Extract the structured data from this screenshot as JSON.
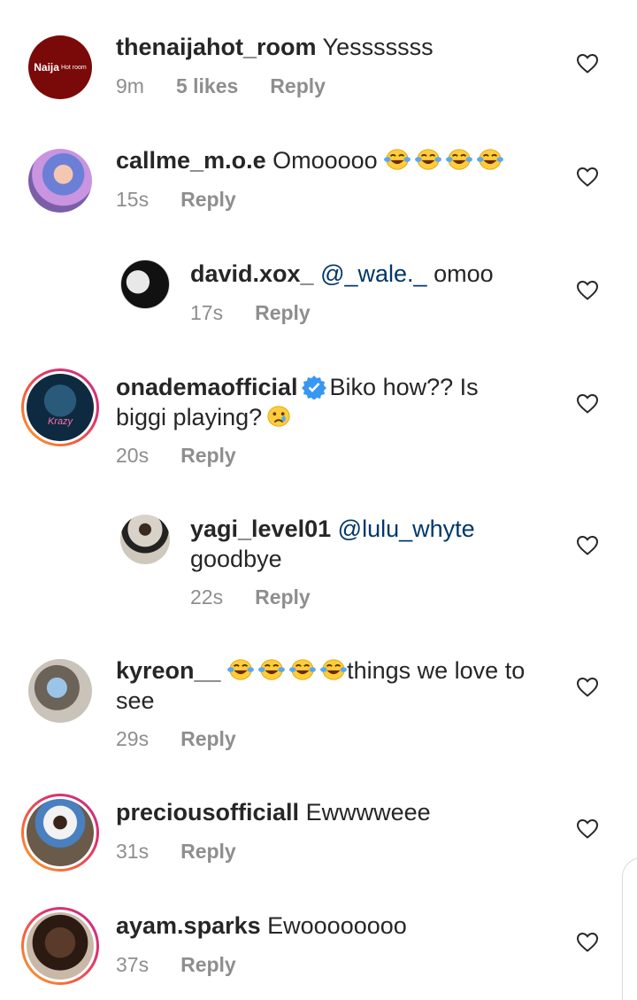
{
  "comments": [
    {
      "username": "thenaijahot_room",
      "text": "Yesssssss",
      "time": "9m",
      "likes": "5 likes",
      "reply": "Reply",
      "avatar_text": "Naija",
      "avatar_subtext": "Hot room"
    },
    {
      "username": "callme_m.o.e",
      "text": "Omooooo",
      "time": "15s",
      "reply": "Reply"
    },
    {
      "username": "david.xox_",
      "mention": "@_wale._",
      "text": "omoo",
      "time": "17s",
      "reply": "Reply"
    },
    {
      "username": "onademaofficial",
      "text": "Biko how?? Is biggi playing?",
      "time": "20s",
      "reply": "Reply",
      "avatar_text": "Krazy"
    },
    {
      "username": "yagi_level01",
      "mention": "@lulu_whyte",
      "text": "goodbye",
      "time": "22s",
      "reply": "Reply"
    },
    {
      "username": "kyreon__",
      "text": "things we love to see",
      "time": "29s",
      "reply": "Reply"
    },
    {
      "username": "preciousofficiall",
      "text": "Ewwwweee",
      "time": "31s",
      "reply": "Reply"
    },
    {
      "username": "ayam.sparks",
      "text": "Ewoooooooo",
      "time": "37s",
      "reply": "Reply"
    }
  ],
  "icons": {
    "like": "heart-outline-icon",
    "verified": "verified-badge-icon",
    "emoji": "face-with-tears-of-joy",
    "emoji_sad": "crying-face"
  },
  "colors": {
    "text": "#262626",
    "meta": "#8e8e8e",
    "mention": "#00376b",
    "verified": "#3897f0"
  }
}
